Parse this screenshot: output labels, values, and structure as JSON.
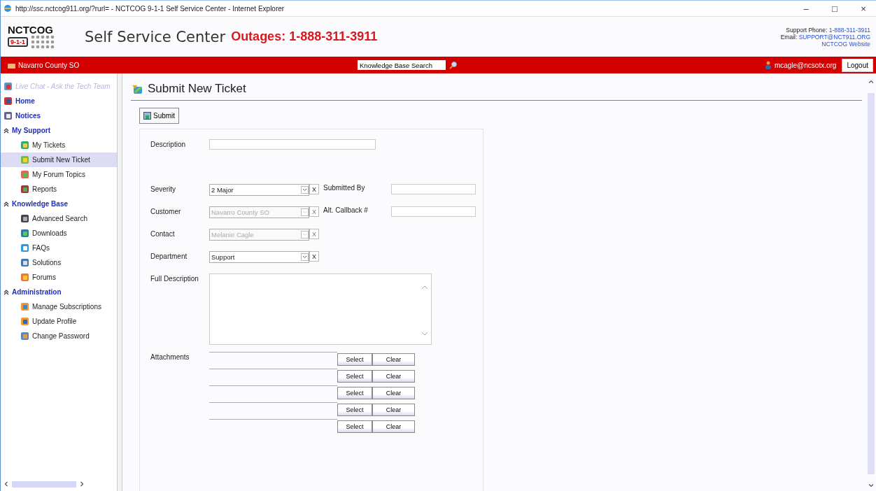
{
  "window": {
    "title": "http://ssc.nctcog911.org/?rurl= - NCTCOG 9-1-1 Self Service Center - Internet Explorer",
    "controls": [
      "–",
      "□",
      "×"
    ]
  },
  "header": {
    "logo_top": "NCTCOG",
    "logo_badge": "9-1-1",
    "site_title": "Self Service Center",
    "outage": "Outages: 1-888-311-3911",
    "support_label": "Support Phone:",
    "support_phone": "1-888-311-3911",
    "email_label": "Email:",
    "email": "SUPPORT@NCT911.ORG",
    "website": "NCTCOG Website"
  },
  "navbar": {
    "account": "Navarro County SO",
    "search_value": "Knowledge Base Search",
    "user": "mcagle@ncsotx.org",
    "logout": "Logout"
  },
  "sidebar": {
    "items": [
      {
        "label": "Live Chat - Ask the Tech Team",
        "kind": "link",
        "disabled": true,
        "selected": false
      },
      {
        "label": "Home",
        "kind": "link",
        "disabled": false,
        "selected": false
      },
      {
        "label": "Notices",
        "kind": "link",
        "disabled": false,
        "selected": false
      },
      {
        "label": "My Support",
        "kind": "section",
        "expanded": true,
        "children": [
          {
            "label": "My Tickets",
            "selected": false
          },
          {
            "label": "Submit New Ticket",
            "selected": true
          },
          {
            "label": "My Forum Topics",
            "selected": false
          },
          {
            "label": "Reports",
            "selected": false
          }
        ]
      },
      {
        "label": "Knowledge Base",
        "kind": "section",
        "expanded": true,
        "children": [
          {
            "label": "Advanced Search",
            "selected": false
          },
          {
            "label": "Downloads",
            "selected": false
          },
          {
            "label": "FAQs",
            "selected": false
          },
          {
            "label": "Solutions",
            "selected": false
          },
          {
            "label": "Forums",
            "selected": false
          }
        ]
      },
      {
        "label": "Administration",
        "kind": "section",
        "expanded": true,
        "children": [
          {
            "label": "Manage Subscriptions",
            "selected": false
          },
          {
            "label": "Update Profile",
            "selected": false
          },
          {
            "label": "Change Password",
            "selected": false
          }
        ]
      }
    ]
  },
  "page": {
    "title": "Submit New Ticket",
    "submit": "Submit"
  },
  "form": {
    "fields": [
      {
        "label": "Description",
        "kind": "text"
      },
      {
        "label": "Severity",
        "kind": "combo",
        "value": "2 Major",
        "disabled": false,
        "clear": "X",
        "side": {
          "label": "Submitted By"
        }
      },
      {
        "label": "Customer",
        "kind": "combo",
        "value": "Navarro County SO",
        "disabled": true,
        "clear": "X",
        "side": {
          "label": "Alt. Callback #"
        }
      },
      {
        "label": "Contact",
        "kind": "combo",
        "value": "Melanie Cagle",
        "disabled": true,
        "clear": "X"
      },
      {
        "label": "Department",
        "kind": "combo",
        "value": "Support",
        "disabled": false,
        "clear": "X"
      },
      {
        "label": "Full Description",
        "kind": "textarea"
      }
    ],
    "attachments": {
      "label": "Attachments",
      "rows": [
        {
          "select": "Select",
          "clear": "Clear"
        },
        {
          "select": "Select",
          "clear": "Clear"
        },
        {
          "select": "Select",
          "clear": "Clear"
        },
        {
          "select": "Select",
          "clear": "Clear"
        },
        {
          "select": "Select",
          "clear": "Clear"
        }
      ]
    }
  }
}
